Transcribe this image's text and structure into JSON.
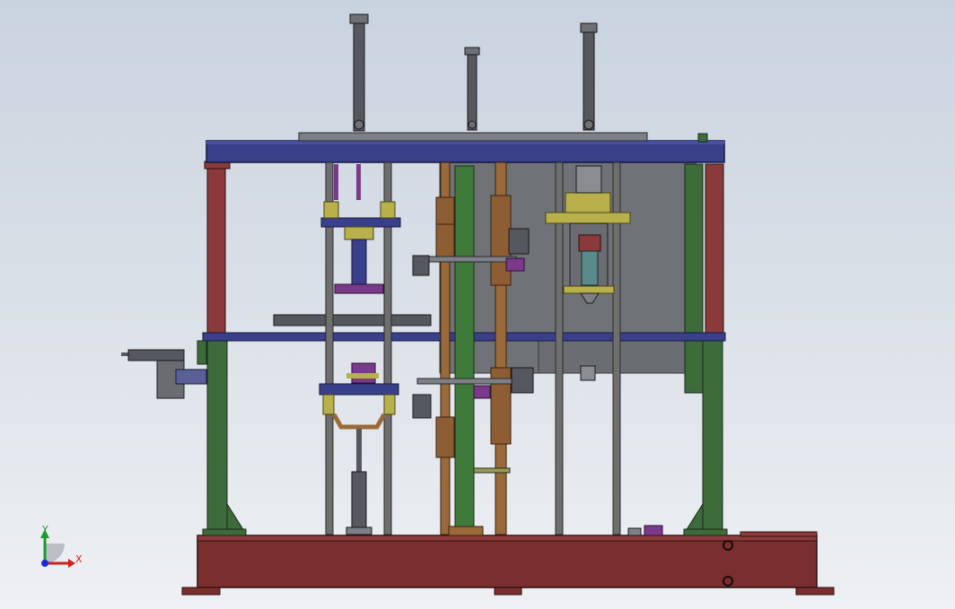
{
  "viewport": {
    "background_top": "#c9d3df",
    "background_bottom": "#eef0f3"
  },
  "colors": {
    "frame_blue": "#3a3f8a",
    "post_red": "#8a3a3a",
    "post_green": "#3d6b3a",
    "base_maroon": "#7a2e2e",
    "column_brown": "#9a6a3a",
    "column_green": "#3f7a3a",
    "back_panel": "#6f7377",
    "rod_grey": "#6e6e6e",
    "plate_olive": "#b8b04a",
    "accent_purple": "#7a3a8a"
  },
  "triad": {
    "x_label": "X",
    "y_label": "Y",
    "x_color": "#d12020",
    "y_color": "#1a9a2a",
    "z_color": "#1a2ad1"
  }
}
